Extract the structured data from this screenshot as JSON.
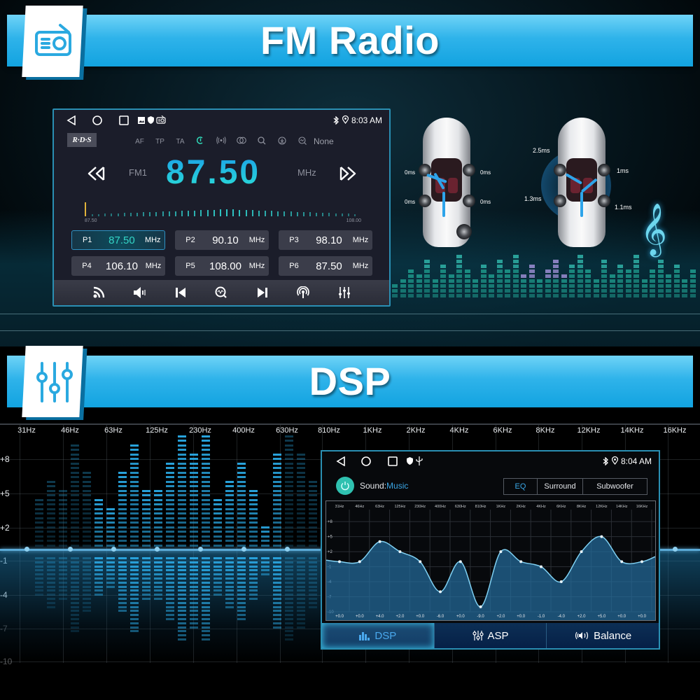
{
  "sections": {
    "fm_title": "FM Radio",
    "dsp_title": "DSP"
  },
  "radio": {
    "status_bar": {
      "time": "8:03 AM"
    },
    "rds_badge": "R·D·S",
    "rds_options": [
      "AF",
      "TP",
      "TA"
    ],
    "rds_none": "None",
    "band": "FM1",
    "frequency": "87.50",
    "unit": "MHz",
    "scale_min": "87.50",
    "scale_max": "108.00",
    "tuner_position_fraction": 0.0,
    "presets": [
      {
        "label": "P1",
        "freq": "87.50",
        "unit": "MHz",
        "active": true
      },
      {
        "label": "P2",
        "freq": "90.10",
        "unit": "MHz",
        "active": false
      },
      {
        "label": "P3",
        "freq": "98.10",
        "unit": "MHz",
        "active": false
      },
      {
        "label": "P4",
        "freq": "106.10",
        "unit": "MHz",
        "active": false
      },
      {
        "label": "P5",
        "freq": "108.00",
        "unit": "MHz",
        "active": false
      },
      {
        "label": "P6",
        "freq": "87.50",
        "unit": "MHz",
        "active": false
      }
    ],
    "toolbar": [
      "rds-signal-icon",
      "volume-icon",
      "previous-icon",
      "search-icon",
      "next-icon",
      "broadcast-icon",
      "equalizer-icon"
    ]
  },
  "speaker_delay": {
    "car1": {
      "front_left": "0ms",
      "front_right": "0ms",
      "rear_left": "0ms",
      "rear_right": "0ms"
    },
    "car2": {
      "front_left": "2.5ms",
      "front_right": "1ms",
      "rear_left": "1.3ms",
      "rear_right": "1.1ms"
    }
  },
  "dsp_background": {
    "frequencies": [
      "31Hz",
      "46Hz",
      "63Hz",
      "125Hz",
      "230Hz",
      "400Hz",
      "630Hz",
      "810Hz",
      "1KHz",
      "2KHz",
      "4KHz",
      "6KHz",
      "8KHz",
      "12KHz",
      "14KHz",
      "16KHz"
    ],
    "y_labels": [
      "+8",
      "+5",
      "+2",
      "-1",
      "-4",
      "-7",
      "-10"
    ]
  },
  "dsp": {
    "status_bar": {
      "time": "8:04 AM"
    },
    "sound_label": "Sound:",
    "sound_value": "Music",
    "segments": [
      {
        "label": "EQ",
        "active": true
      },
      {
        "label": "Surround",
        "active": false
      },
      {
        "label": "Subwoofer",
        "active": false
      }
    ],
    "tabs": [
      {
        "label": "DSP",
        "active": true
      },
      {
        "label": "ASP",
        "active": false
      },
      {
        "label": "Balance",
        "active": false
      }
    ]
  },
  "chart_data": {
    "type": "line",
    "title": "",
    "xlabel": "",
    "ylabel": "",
    "categories": [
      "31Hz",
      "46Hz",
      "63Hz",
      "125Hz",
      "230Hz",
      "400Hz",
      "630Hz",
      "810Hz",
      "1KHz",
      "2KHz",
      "4KHz",
      "6KHz",
      "8KHz",
      "12KHz",
      "14KHz",
      "16KHz"
    ],
    "values": [
      0,
      0,
      4,
      2,
      0,
      -6,
      0,
      -9,
      2,
      0,
      -1,
      -4,
      2,
      5,
      0,
      0
    ],
    "value_labels": [
      "+0.0",
      "+0.0",
      "+4.0",
      "+2.0",
      "+0.0",
      "-6.0",
      "+0.0",
      "-9.0",
      "+2.0",
      "+0.0",
      "-1.0",
      "-4.0",
      "+2.0",
      "+5.0",
      "+0.0",
      "+0.0"
    ],
    "y_ticks": [
      "+8",
      "+5",
      "+2",
      "-1",
      "-4",
      "-7",
      "-10"
    ],
    "ylim": [
      -10,
      9
    ],
    "grid": true,
    "fill": "area"
  }
}
